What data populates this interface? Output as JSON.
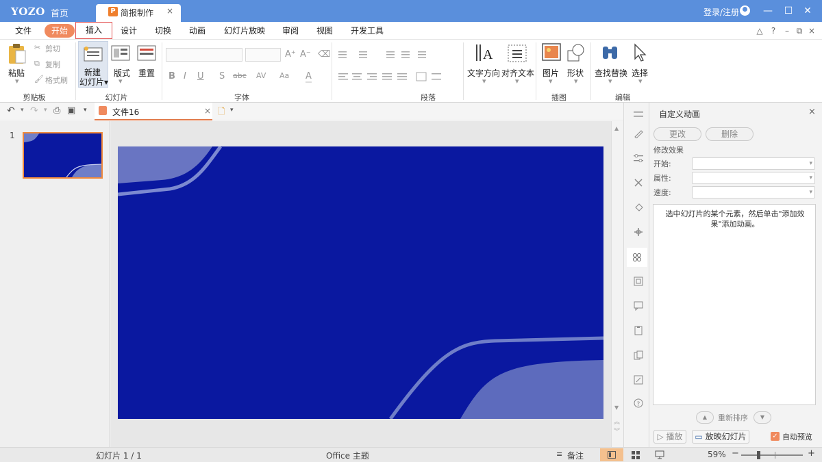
{
  "titlebar": {
    "logo": "YOZO",
    "home": "首页",
    "doc_tab": "简报制作",
    "doc_tab_close": "×",
    "login": "登录/注册",
    "colors": {
      "titlebar": "#5a8fdc",
      "accent_orange": "#f08a5e",
      "slide_blue": "#0a18a0"
    }
  },
  "menu": {
    "tabs": [
      "文件",
      "开始",
      "插入",
      "设计",
      "切换",
      "动画",
      "幻灯片放映",
      "审阅",
      "视图",
      "开发工具"
    ],
    "active": "开始",
    "highlighted": "插入",
    "right_icons": [
      "up-caret-icon",
      "help-icon",
      "minimize-icon",
      "restore-icon",
      "close-icon"
    ],
    "right_glyphs": [
      "△",
      "?",
      "–",
      "⧉",
      "×"
    ]
  },
  "ribbon": {
    "clipboard": {
      "paste": "粘贴",
      "cut": "剪切",
      "copy": "复制",
      "format_painter": "格式刷",
      "group": "剪贴板"
    },
    "slides": {
      "new_slide_1": "新建",
      "new_slide_2": "幻灯片▾",
      "layout": "版式",
      "reset": "重置",
      "group": "幻灯片"
    },
    "font": {
      "group": "字体",
      "bold": "B",
      "italic": "I",
      "underline": "U",
      "shadow": "S",
      "strike": "abc",
      "spacing": "AV",
      "case": "Aa",
      "grow": "A⁺",
      "shrink": "A⁻",
      "color": "A"
    },
    "paragraph": {
      "group": "段落"
    },
    "text": {
      "direction": "文字方向",
      "align": "对齐文本"
    },
    "insert": {
      "picture": "图片",
      "shape": "形状",
      "group": "插图"
    },
    "edit": {
      "find_replace": "查找替换",
      "select": "选择",
      "group": "编辑"
    }
  },
  "quickbar": {
    "file_tab": "文件16",
    "file_tab_close": "×"
  },
  "slides_pane": {
    "slide_number": "1"
  },
  "animation_panel": {
    "title": "自定义动画",
    "change": "更改",
    "delete": "删除",
    "modify_effect": "修改效果",
    "start_label": "开始:",
    "property_label": "属性:",
    "speed_label": "速度:",
    "hint": "选中幻灯片的某个元素，然后单击\"添加效果\"添加动画。",
    "reorder": "重新排序",
    "play": "播放",
    "slideshow": "放映幻灯片",
    "autopreview": "自动预览",
    "autopreview_checked": true
  },
  "statusbar": {
    "slide_info": "幻灯片 1 / 1",
    "theme": "Office 主题",
    "notes": "备注",
    "zoom": "59%",
    "zoom_level": 0.59
  }
}
